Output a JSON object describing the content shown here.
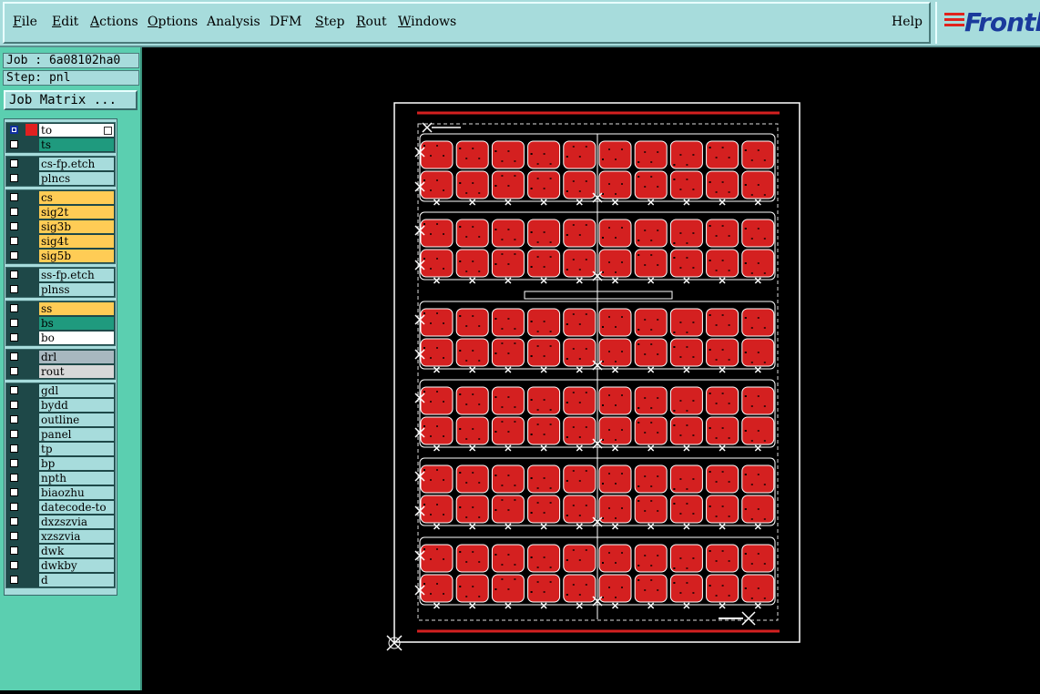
{
  "menubar": {
    "items": [
      {
        "label": "File",
        "u": "F"
      },
      {
        "label": "Edit",
        "u": "E"
      },
      {
        "label": "Actions",
        "u": "A"
      },
      {
        "label": "Options",
        "u": "O"
      },
      {
        "label": "Analysis",
        "u": ""
      },
      {
        "label": "DFM",
        "u": ""
      },
      {
        "label": "Step",
        "u": "S"
      },
      {
        "label": "Rout",
        "u": "R"
      },
      {
        "label": "Windows",
        "u": "W"
      }
    ],
    "help": "Help",
    "logo": "Frontl"
  },
  "job": {
    "label": "Job : 6a08102ha0",
    "step": "Step: pnl"
  },
  "job_matrix_button": "Job Matrix ...",
  "layer_groups": [
    [
      {
        "name": "to",
        "color": "white",
        "active": true,
        "swatch": true
      },
      {
        "name": "ts",
        "color": "teal"
      }
    ],
    [
      {
        "name": "cs-fp.etch",
        "color": "cyan"
      },
      {
        "name": "plncs",
        "color": "cyan"
      }
    ],
    [
      {
        "name": "cs",
        "color": "orange"
      },
      {
        "name": "sig2t",
        "color": "orange"
      },
      {
        "name": "sig3b",
        "color": "orange"
      },
      {
        "name": "sig4t",
        "color": "orange"
      },
      {
        "name": "sig5b",
        "color": "orange"
      }
    ],
    [
      {
        "name": "ss-fp.etch",
        "color": "cyan"
      },
      {
        "name": "plnss",
        "color": "cyan"
      }
    ],
    [
      {
        "name": "ss",
        "color": "orange"
      },
      {
        "name": "bs",
        "color": "teal"
      },
      {
        "name": "bo",
        "color": "white"
      }
    ],
    [
      {
        "name": "drl",
        "color": "slate"
      },
      {
        "name": "rout",
        "color": "lgray"
      }
    ],
    [
      {
        "name": "gdl",
        "color": "cyan"
      },
      {
        "name": "bydd",
        "color": "cyan"
      },
      {
        "name": "outline",
        "color": "cyan"
      },
      {
        "name": "panel",
        "color": "cyan"
      },
      {
        "name": "tp",
        "color": "cyan"
      },
      {
        "name": "bp",
        "color": "cyan"
      },
      {
        "name": "npth",
        "color": "cyan"
      },
      {
        "name": "biaozhu",
        "color": "cyan"
      },
      {
        "name": "datecode-to",
        "color": "cyan"
      },
      {
        "name": "dxzszvia",
        "color": "cyan"
      },
      {
        "name": "xzszvia",
        "color": "cyan"
      },
      {
        "name": "dwk",
        "color": "cyan"
      },
      {
        "name": "dwkby",
        "color": "cyan"
      },
      {
        "name": "d",
        "color": "cyan"
      }
    ]
  ],
  "panel_view": {
    "columns": 10,
    "row_pairs": 6,
    "board_color": "#d42020",
    "outline_color": "#ffffff",
    "background": "#000000"
  },
  "colors": {
    "menubar": "#a7dcdc",
    "leftpanel": "#5bcfb0",
    "orange": "#ffcc55",
    "teal": "#1f9a7e"
  }
}
